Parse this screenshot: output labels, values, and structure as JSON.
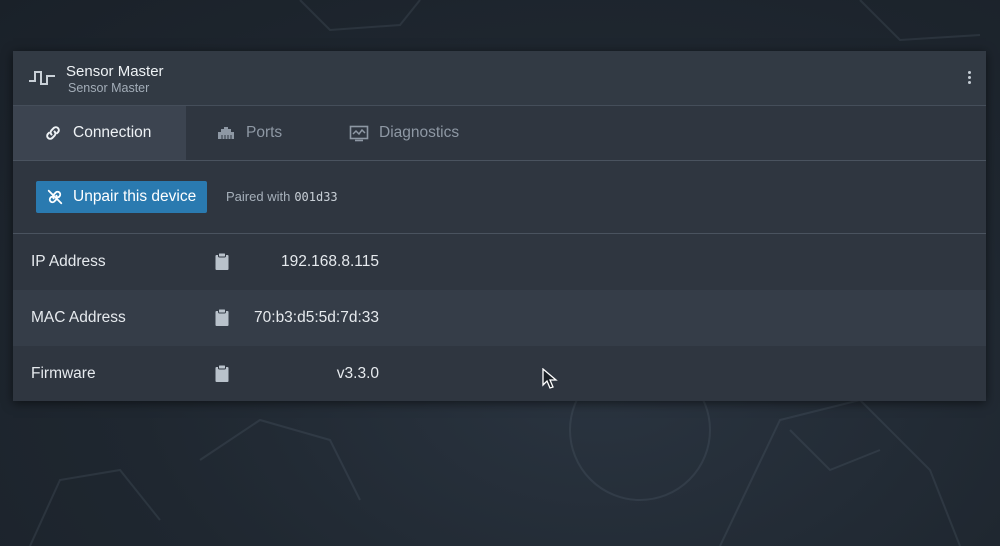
{
  "app": {
    "title": "Sensor Master",
    "subtitle": "Sensor Master"
  },
  "tabs": [
    {
      "label": "Connection",
      "icon": "link-icon",
      "active": true
    },
    {
      "label": "Ports",
      "icon": "ethernet-port-icon",
      "active": false
    },
    {
      "label": "Diagnostics",
      "icon": "monitor-chart-icon",
      "active": false
    }
  ],
  "connection": {
    "unpair_label": "Unpair this device",
    "paired_prefix": "Paired with",
    "paired_id": "001d33"
  },
  "info": [
    {
      "label": "IP Address",
      "value": "192.168.8.115"
    },
    {
      "label": "MAC Address",
      "value": "70:b3:d5:5d:7d:33"
    },
    {
      "label": "Firmware",
      "value": "v3.3.0"
    }
  ],
  "colors": {
    "accent": "#2a7ab0",
    "card_bg": "#2f3640",
    "active_tab_bg": "#3c4450",
    "text_primary": "#e6eaee",
    "text_muted": "#8e98a4"
  }
}
